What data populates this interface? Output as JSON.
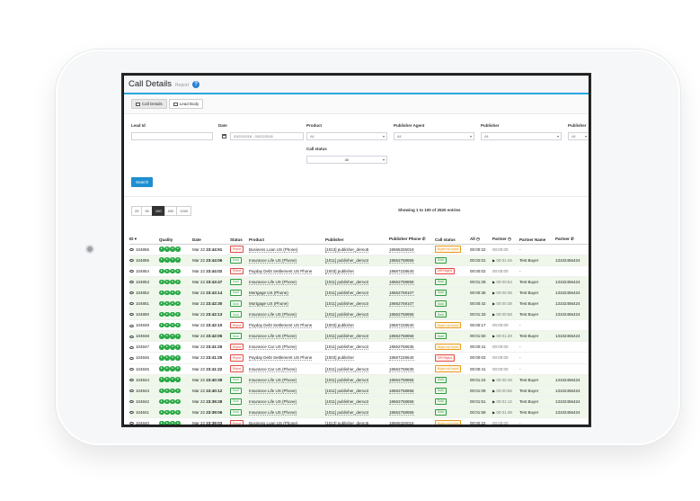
{
  "header": {
    "title": "Call Details",
    "subtitle": "Report"
  },
  "tabs": [
    {
      "label": "Call Details",
      "active": true
    },
    {
      "label": "Lead Body",
      "active": false
    }
  ],
  "filters": {
    "lead_id": {
      "label": "Lead Id",
      "value": ""
    },
    "date": {
      "label": "Date",
      "value": "03/22/2018 - 03/22/2018"
    },
    "product": {
      "label": "Product",
      "value": "All"
    },
    "publisher_agent": {
      "label": "Publisher Agent",
      "value": "All"
    },
    "publisher": {
      "label": "Publisher",
      "value": "All"
    },
    "publisher_extra": {
      "label": "Publisher",
      "value": "All"
    },
    "call_status": {
      "label": "Call status",
      "value": "All"
    },
    "search_label": "Search"
  },
  "pager": {
    "sizes": [
      "25",
      "50",
      "100",
      "500",
      "1000"
    ],
    "active": "100"
  },
  "entries_text": "Showing 1 to 100 of 2520 entries",
  "columns": [
    "ID",
    "Quality",
    "Date",
    "Status",
    "Product",
    "Publisher",
    "Publisher Phone",
    "Call status",
    "All",
    "Partner",
    "Partner Name",
    "Partner"
  ],
  "rows": [
    {
      "id": "104856",
      "date": "Mar 22",
      "time": "23:44:51",
      "status": "Reject",
      "product": "Business Loan US (Phone)",
      "publisher": "[1013] publisher_demo5",
      "phone": "18665326018",
      "call_status": "Buyer not found",
      "all": "00:00:22",
      "partner_time": "00:00:00",
      "partner_name": "-",
      "partner_phone": ""
    },
    {
      "id": "104855",
      "date": "Mar 22",
      "time": "23:44:06",
      "status": "Sold",
      "product": "Insurance Life US (Phone)",
      "publisher": "[1011] publisher_demo3",
      "phone": "18662758858",
      "call_status": "Sold",
      "all": "00:02:01",
      "partner_time": "00:01:26",
      "partner_name": "Test Buyer",
      "partner_phone": "13102456424"
    },
    {
      "id": "104854",
      "date": "Mar 22",
      "time": "23:44:02",
      "status": "Reject",
      "product": "Payday Debt Settlement US Phone",
      "publisher": "[1003] publisher",
      "phone": "18667228640",
      "call_status": "IVR Reject",
      "all": "00:00:02",
      "partner_time": "00:00:00",
      "partner_name": "-",
      "partner_phone": ""
    },
    {
      "id": "104853",
      "date": "Mar 22",
      "time": "23:43:47",
      "status": "Sold",
      "product": "Insurance Life US (Phone)",
      "publisher": "[1011] publisher_demo3",
      "phone": "18662758858",
      "call_status": "Sold",
      "all": "00:01:28",
      "partner_time": "00:00:54",
      "partner_name": "Test Buyer",
      "partner_phone": "13102456424"
    },
    {
      "id": "104852",
      "date": "Mar 22",
      "time": "23:43:14",
      "status": "Sold",
      "product": "Mortgage US (Phone)",
      "publisher": "[1011] publisher_demo3",
      "phone": "18662759107",
      "call_status": "Sold",
      "all": "00:00:36",
      "partner_time": "00:00:36",
      "partner_name": "Test Buyer",
      "partner_phone": "13102456424"
    },
    {
      "id": "104851",
      "date": "Mar 22",
      "time": "23:42:30",
      "status": "Sold",
      "product": "Mortgage US (Phone)",
      "publisher": "[1011] publisher_demo3",
      "phone": "18662759107",
      "call_status": "Sold",
      "all": "00:00:42",
      "partner_time": "00:00:38",
      "partner_name": "Test Buyer",
      "partner_phone": "13102456424"
    },
    {
      "id": "104850",
      "date": "Mar 22",
      "time": "23:42:13",
      "status": "Sold",
      "product": "Insurance Life US (Phone)",
      "publisher": "[1011] publisher_demo3",
      "phone": "18662758858",
      "call_status": "Sold",
      "all": "00:01:33",
      "partner_time": "00:00:58",
      "partner_name": "Test Buyer",
      "partner_phone": "13102456424"
    },
    {
      "id": "104849",
      "date": "Mar 22",
      "time": "23:42:10",
      "status": "Reject",
      "product": "Payday Debt Settlement US Phone",
      "publisher": "[1003] publisher",
      "phone": "18667228640",
      "call_status": "Buyer not found",
      "all": "00:00:17",
      "partner_time": "00:00:00",
      "partner_name": "-",
      "partner_phone": ""
    },
    {
      "id": "104848",
      "date": "Mar 22",
      "time": "23:42:05",
      "status": "Sold",
      "product": "Insurance Life US (Phone)",
      "publisher": "[1011] publisher_demo3",
      "phone": "18662758858",
      "call_status": "Sold",
      "all": "00:01:50",
      "partner_time": "00:01:28",
      "partner_name": "Test Buyer",
      "partner_phone": "13102456424"
    },
    {
      "id": "104847",
      "date": "Mar 22",
      "time": "23:41:25",
      "status": "Reject",
      "product": "Insurance Car US (Phone)",
      "publisher": "[1011] publisher_demo3",
      "phone": "18662758635",
      "call_status": "Buyer not found",
      "all": "00:00:41",
      "partner_time": "00:00:00",
      "partner_name": "-",
      "partner_phone": ""
    },
    {
      "id": "104846",
      "date": "Mar 22",
      "time": "23:41:25",
      "status": "Reject",
      "product": "Payday Debt Settlement US Phone",
      "publisher": "[1003] publisher",
      "phone": "18667228640",
      "call_status": "IVR Reject",
      "all": "00:00:02",
      "partner_time": "00:00:00",
      "partner_name": "-",
      "partner_phone": ""
    },
    {
      "id": "104845",
      "date": "Mar 22",
      "time": "23:41:22",
      "status": "Reject",
      "product": "Insurance Car US (Phone)",
      "publisher": "[1011] publisher_demo3",
      "phone": "18662758635",
      "call_status": "Buyer not found",
      "all": "00:00:41",
      "partner_time": "00:00:00",
      "partner_name": "-",
      "partner_phone": ""
    },
    {
      "id": "104844",
      "date": "Mar 22",
      "time": "23:40:39",
      "status": "Sold",
      "product": "Insurance Life US (Phone)",
      "publisher": "[1011] publisher_demo3",
      "phone": "18662758858",
      "call_status": "Sold",
      "all": "00:01:24",
      "partner_time": "00:00:48",
      "partner_name": "Test Buyer",
      "partner_phone": "13102456424"
    },
    {
      "id": "104843",
      "date": "Mar 22",
      "time": "23:40:12",
      "status": "Sold",
      "product": "Insurance Life US (Phone)",
      "publisher": "[1011] publisher_demo3",
      "phone": "18662758858",
      "call_status": "Sold",
      "all": "00:01:09",
      "partner_time": "00:00:56",
      "partner_name": "Test Buyer",
      "partner_phone": "13102456424"
    },
    {
      "id": "104842",
      "date": "Mar 22",
      "time": "23:39:28",
      "status": "Sold",
      "product": "Insurance Life US (Phone)",
      "publisher": "[1011] publisher_demo3",
      "phone": "18662758858",
      "call_status": "Sold",
      "all": "00:01:51",
      "partner_time": "00:01:12",
      "partner_name": "Test Buyer",
      "partner_phone": "13102456424"
    },
    {
      "id": "104841",
      "date": "Mar 22",
      "time": "23:39:06",
      "status": "Sold",
      "product": "Insurance Life US (Phone)",
      "publisher": "[1011] publisher_demo3",
      "phone": "18662758858",
      "call_status": "Sold",
      "all": "00:01:59",
      "partner_time": "00:01:38",
      "partner_name": "Test Buyer",
      "partner_phone": "13102456424"
    },
    {
      "id": "104840",
      "date": "Mar 22",
      "time": "23:39:03",
      "status": "Reject",
      "product": "Business Loan US (Phone)",
      "publisher": "[1013] publisher_demo5",
      "phone": "18665326018",
      "call_status": "Buyer not found",
      "all": "00:00:22",
      "partner_time": "00:00:00",
      "partner_name": "-",
      "partner_phone": ""
    }
  ]
}
